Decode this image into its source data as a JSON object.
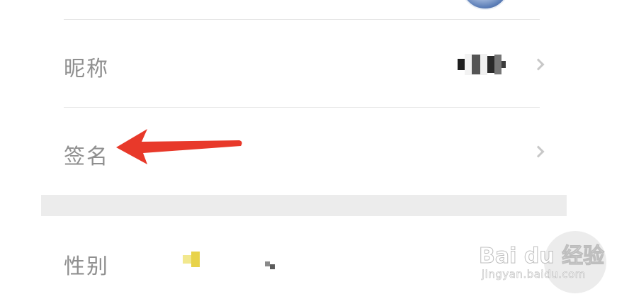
{
  "profile": {
    "rows": [
      {
        "label": "昵称"
      },
      {
        "label": "签名"
      },
      {
        "label": "性别"
      }
    ]
  },
  "watermark": {
    "brand": "Bai du 经验",
    "url": "jingyan.baidu.com"
  },
  "colors": {
    "annotation_arrow": "#e8392a",
    "section_gap": "#ececec",
    "label_text": "#8f8f8f"
  }
}
